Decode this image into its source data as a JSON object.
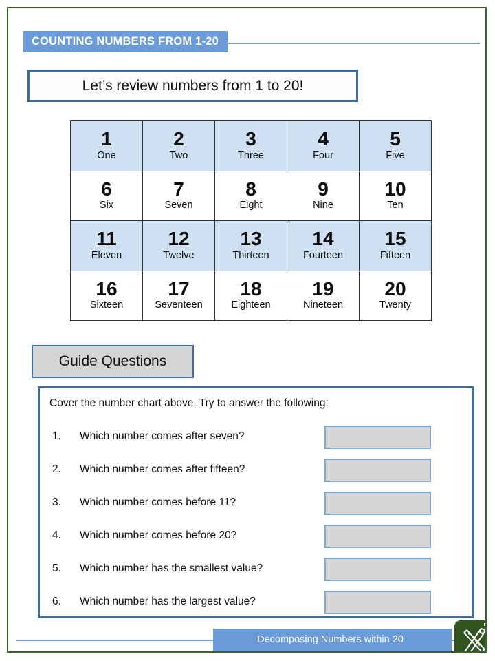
{
  "header": {
    "banner_title": "COUNTING NUMBERS FROM 1-20"
  },
  "intro": {
    "text": "Let’s review numbers from 1 to 20!"
  },
  "number_chart": {
    "rows": [
      [
        {
          "numeral": "1",
          "word": "One"
        },
        {
          "numeral": "2",
          "word": "Two"
        },
        {
          "numeral": "3",
          "word": "Three"
        },
        {
          "numeral": "4",
          "word": "Four"
        },
        {
          "numeral": "5",
          "word": "Five"
        }
      ],
      [
        {
          "numeral": "6",
          "word": "Six"
        },
        {
          "numeral": "7",
          "word": "Seven"
        },
        {
          "numeral": "8",
          "word": "Eight"
        },
        {
          "numeral": "9",
          "word": "Nine"
        },
        {
          "numeral": "10",
          "word": "Ten"
        }
      ],
      [
        {
          "numeral": "11",
          "word": "Eleven"
        },
        {
          "numeral": "12",
          "word": "Twelve"
        },
        {
          "numeral": "13",
          "word": "Thirteen"
        },
        {
          "numeral": "14",
          "word": "Fourteen"
        },
        {
          "numeral": "15",
          "word": "Fifteen"
        }
      ],
      [
        {
          "numeral": "16",
          "word": "Sixteen"
        },
        {
          "numeral": "17",
          "word": "Seventeen"
        },
        {
          "numeral": "18",
          "word": "Eighteen"
        },
        {
          "numeral": "19",
          "word": "Nineteen"
        },
        {
          "numeral": "20",
          "word": "Twenty"
        }
      ]
    ]
  },
  "guide": {
    "title": "Guide Questions",
    "prompt": "Cover the number chart above. Try to answer the following:",
    "questions": [
      {
        "number": "1.",
        "text": "Which number comes after seven?",
        "answer": ""
      },
      {
        "number": "2.",
        "text": "Which number comes after fifteen?",
        "answer": ""
      },
      {
        "number": "3.",
        "text": "Which number comes before 11?",
        "answer": ""
      },
      {
        "number": "4.",
        "text": "Which number comes before 20?",
        "answer": ""
      },
      {
        "number": "5.",
        "text": "Which number has the smallest value?",
        "answer": ""
      },
      {
        "number": "6.",
        "text": "Which number has the largest value?",
        "answer": ""
      }
    ]
  },
  "footer": {
    "banner_text": "Decomposing Numbers within 20",
    "logo_icon": "pencil-ruler-icon"
  },
  "colors": {
    "banner_blue": "#6b9bd8",
    "rule_blue": "#6d9ed6",
    "border_blue": "#3a6ca8",
    "chart_shaded": "#cfe0f3",
    "chart_grid": "#27343f",
    "answer_fill": "#d6d6d6",
    "answer_border": "#7eaad6",
    "guide_fill": "#d4d4d4",
    "page_border_green": "#3c6428",
    "logo_green": "#2f5420"
  }
}
